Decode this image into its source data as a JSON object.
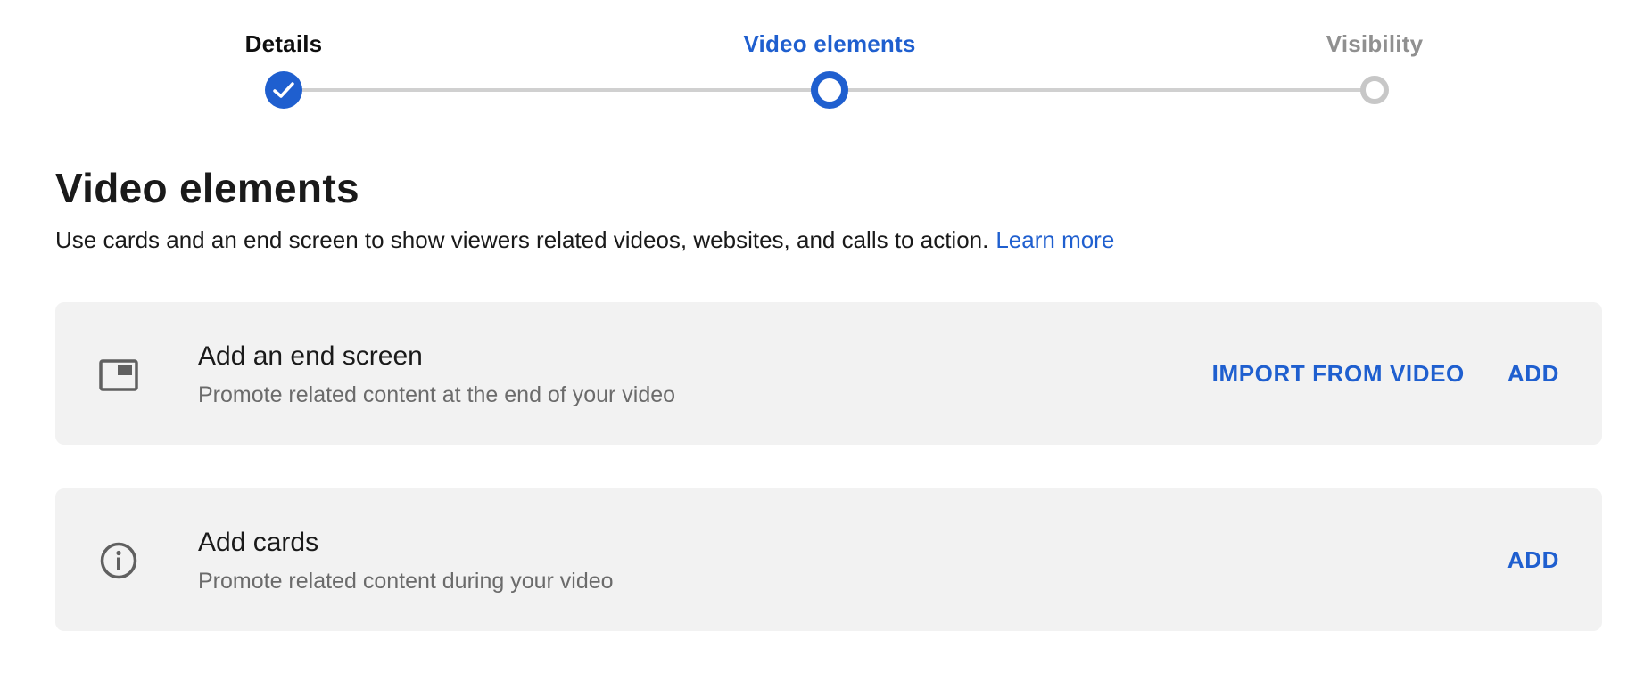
{
  "stepper": {
    "steps": [
      {
        "label": "Details",
        "state": "done"
      },
      {
        "label": "Video elements",
        "state": "active"
      },
      {
        "label": "Visibility",
        "state": "pending"
      }
    ]
  },
  "main": {
    "title": "Video elements",
    "description": "Use cards and an end screen to show viewers related videos, websites, and calls to action.",
    "learn_more": "Learn more"
  },
  "cards": [
    {
      "icon": "end-screen-icon",
      "title": "Add an end screen",
      "subtitle": "Promote related content at the end of your video",
      "actions": [
        "IMPORT FROM VIDEO",
        "ADD"
      ]
    },
    {
      "icon": "info-icon",
      "title": "Add cards",
      "subtitle": "Promote related content during your video",
      "actions": [
        "ADD"
      ]
    }
  ],
  "colors": {
    "accent": "#1f5fcf",
    "card_background": "#f2f2f2",
    "inactive": "#c7c7c7",
    "secondary_text": "#6b6b6b"
  }
}
